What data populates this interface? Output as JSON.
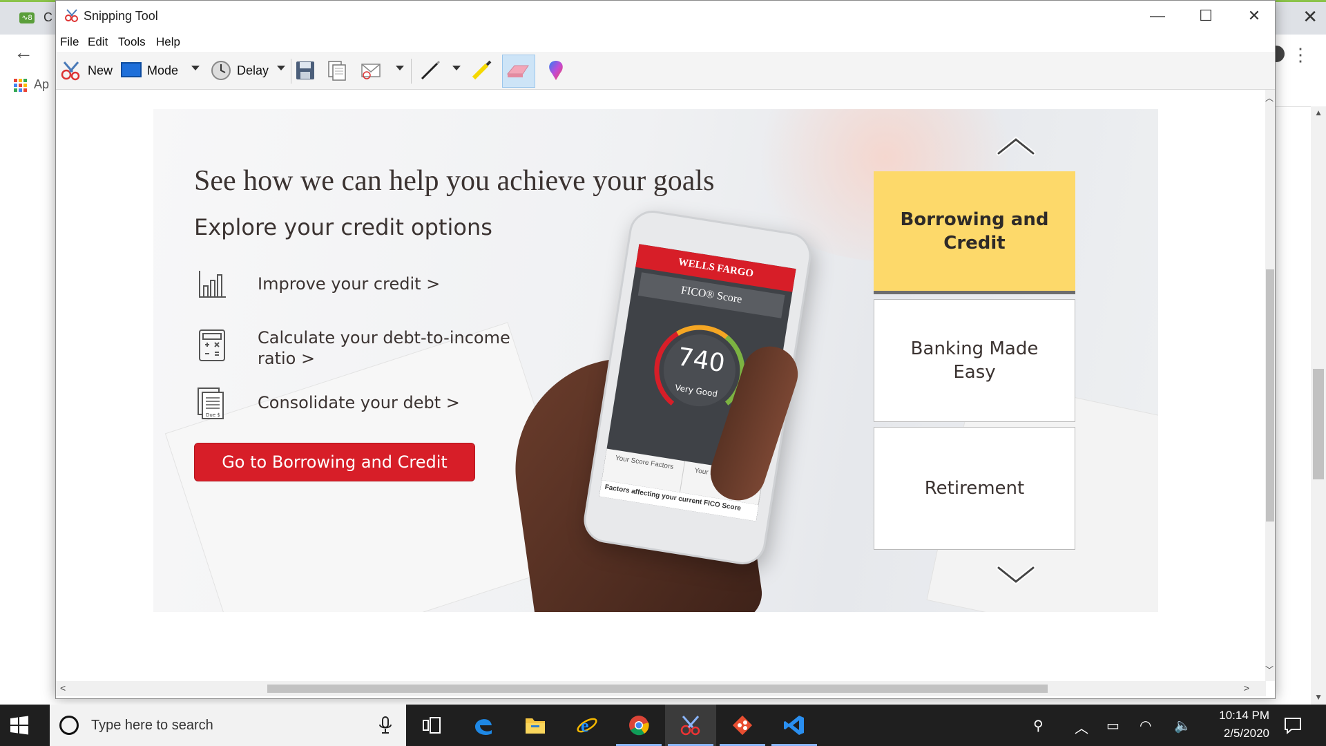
{
  "chrome": {
    "tab_title": "C",
    "favicon_text": "∿8",
    "apps_label": "Ap"
  },
  "window": {
    "title": "Snipping Tool",
    "minimize": "—",
    "maximize": "☐",
    "close": "✕"
  },
  "menu": {
    "items": [
      "File",
      "Edit",
      "Tools",
      "Help"
    ]
  },
  "toolbar": {
    "new_label": "New",
    "mode_label": "Mode",
    "delay_label": "Delay",
    "icons": [
      "new-snip-icon",
      "mode-icon",
      "delay-clock-icon",
      "save-icon",
      "copy-icon",
      "send-email-icon",
      "pen-icon",
      "highlighter-icon",
      "eraser-icon",
      "paint3d-icon"
    ],
    "active_tool": "eraser"
  },
  "banner": {
    "headline": "See how we can help you achieve your goals",
    "subheadline": "Explore your credit options",
    "options": [
      {
        "icon": "bar-chart-icon",
        "text": "Improve your credit >"
      },
      {
        "icon": "calculator-icon",
        "text": "Calculate your debt-to-income ratio >"
      },
      {
        "icon": "bill-document-icon",
        "text": "Consolidate your debt >"
      }
    ],
    "cta": "Go to Borrowing and Credit",
    "bill_icon_text": "Due $"
  },
  "phone": {
    "brand": "WELLS FARGO",
    "screen_title": "FICO® Score",
    "score": "740",
    "rating": "Very Good",
    "tabs": [
      "Your Score Factors",
      "Your Score History"
    ],
    "factors_text": "Factors affecting your current FICO Score"
  },
  "side_tabs": {
    "items": [
      {
        "label": "Borrowing and Credit",
        "selected": true
      },
      {
        "label": "Banking Made Easy",
        "selected": false
      },
      {
        "label": "Retirement",
        "selected": false
      }
    ],
    "selected_color": "#fdd96a"
  },
  "taskbar": {
    "search_placeholder": "Type here to search",
    "apps": [
      "task-view-icon",
      "edge-icon",
      "file-explorer-icon",
      "internet-explorer-icon",
      "chrome-icon",
      "snipping-tool-icon",
      "git-icon",
      "vscode-icon"
    ],
    "active_app": "snipping-tool-icon",
    "time": "10:14 PM",
    "date": "2/5/2020"
  },
  "colors": {
    "brand_red": "#d71e28",
    "selected_tab": "#fdd96a",
    "taskbar": "#1f1f1f"
  }
}
